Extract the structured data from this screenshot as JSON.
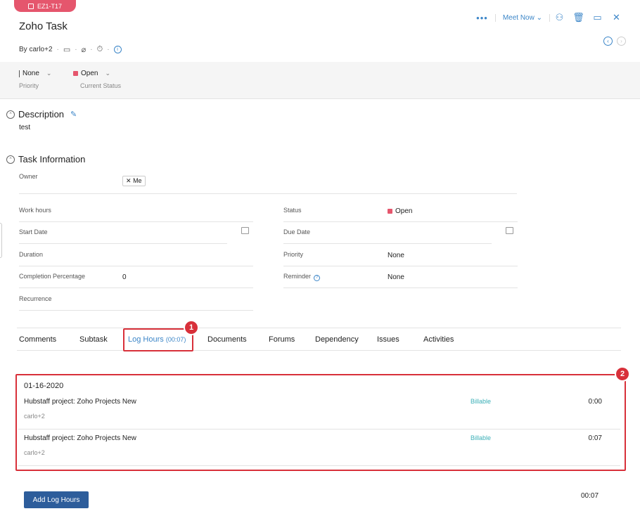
{
  "task": {
    "badge": "EZ1-T17",
    "title": "Zoho Task",
    "by": "By carlo+2"
  },
  "toolbar": {
    "more": "•••",
    "meet_now": "Meet Now"
  },
  "status_bar": {
    "priority_value": "None",
    "priority_label": "Priority",
    "status_value": "Open",
    "status_label": "Current Status",
    "status_color": "#e5566d"
  },
  "description": {
    "heading": "Description",
    "text": "test"
  },
  "task_info": {
    "heading": "Task Information",
    "owner_label": "Owner",
    "owner_value": "Me",
    "work_hours_label": "Work hours",
    "status_label": "Status",
    "status_value": "Open",
    "start_date_label": "Start Date",
    "due_date_label": "Due Date",
    "duration_label": "Duration",
    "priority_label": "Priority",
    "priority_value": "None",
    "completion_label": "Completion Percentage",
    "completion_value": "0",
    "reminder_label": "Reminder",
    "reminder_value": "None",
    "recurrence_label": "Recurrence"
  },
  "tabs": {
    "comments": "Comments",
    "subtask": "Subtask",
    "log_hours": "Log Hours",
    "log_hours_count": "(00:07)",
    "documents": "Documents",
    "forums": "Forums",
    "dependency": "Dependency",
    "issues": "Issues",
    "activities": "Activities"
  },
  "callouts": {
    "one": "1",
    "two": "2"
  },
  "log": {
    "date": "01-16-2020",
    "entries": [
      {
        "project": "Hubstaff project: Zoho Projects New",
        "user": "carlo+2",
        "billing": "Billable",
        "hours": "0:00"
      },
      {
        "project": "Hubstaff project: Zoho Projects New",
        "user": "carlo+2",
        "billing": "Billable",
        "hours": "0:07"
      }
    ],
    "add_button": "Add Log Hours",
    "total": "00:07"
  },
  "colors": {
    "accent": "#3c86c8",
    "highlight": "#d8303a",
    "button": "#2d5d9b",
    "billable": "#3cb0b8"
  }
}
